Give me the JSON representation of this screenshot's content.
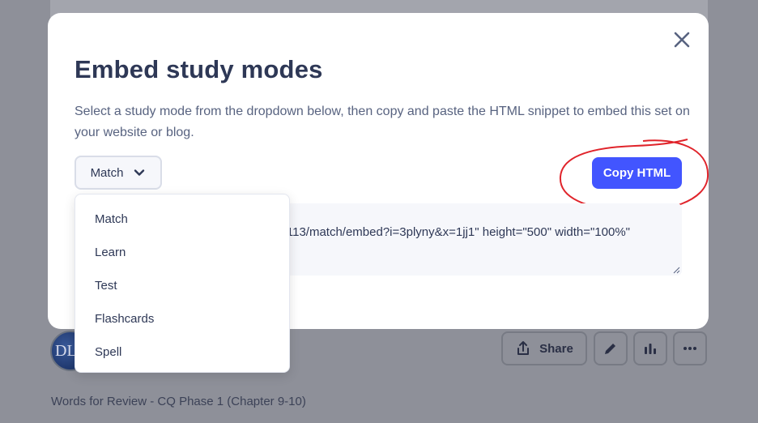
{
  "background": {
    "avatar_initials": "DL",
    "share_label": "Share",
    "set_title": "Words for Review - CQ Phase 1 (Chapter 9-10)"
  },
  "modal": {
    "title": "Embed study modes",
    "description": "Select a study mode from the dropdown below, then copy and paste the HTML snippet to embed this set on your website or blog.",
    "selected_mode": "Match",
    "copy_button_label": "Copy HTML",
    "snippet_visible_text": "52113/match/embed?i=3plyny&x=1jj1\" height=\"500\" width=\"100%\""
  },
  "dropdown": {
    "options": [
      "Match",
      "Learn",
      "Test",
      "Flashcards",
      "Spell"
    ]
  },
  "colors": {
    "primary": "#4255ff",
    "annotation": "#e0242b",
    "overlay": "#8e9099"
  }
}
